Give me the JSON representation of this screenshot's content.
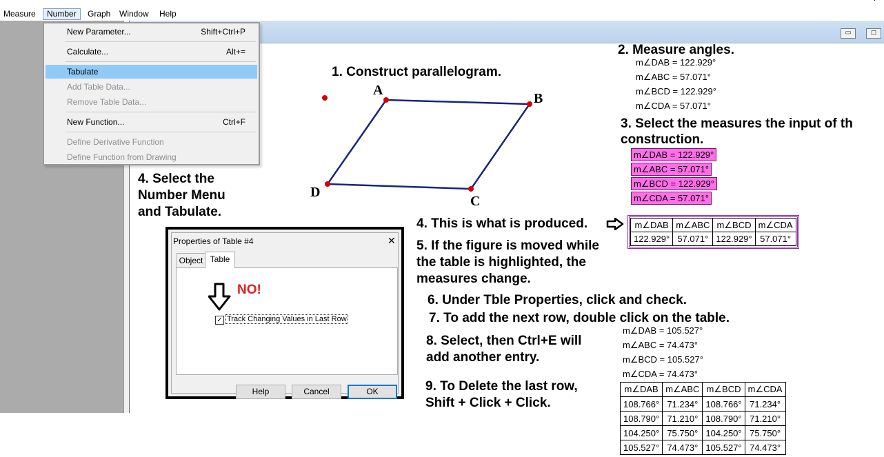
{
  "menubar": [
    "Measure",
    "Number",
    "Graph",
    "Window",
    "Help"
  ],
  "number_menu": [
    {
      "label": "New Parameter...",
      "shortcut": "Shift+Ctrl+P",
      "enabled": true
    },
    {
      "label": "Calculate...",
      "shortcut": "Alt+=",
      "enabled": true
    },
    {
      "label": "Tabulate",
      "shortcut": "",
      "enabled": true,
      "highlighted": true
    },
    {
      "label": "Add Table Data...",
      "shortcut": "",
      "enabled": false
    },
    {
      "label": "Remove Table Data...",
      "shortcut": "",
      "enabled": false
    },
    {
      "label": "New Function...",
      "shortcut": "Ctrl+F",
      "enabled": true
    },
    {
      "label": "Define Derivative Function",
      "shortcut": "",
      "enabled": false
    },
    {
      "label": "Define Function from Drawing",
      "shortcut": "",
      "enabled": false
    }
  ],
  "steps": {
    "s1": "1. Construct parallelogram.",
    "s2": "2. Measure angles.",
    "s3a": "3. Select the measures the input  of th",
    "s3b": "construction.",
    "s4a": "4. Select the",
    "s4b": "Number Menu",
    "s4c": "and Tabulate.",
    "s4p": "4. This is what is produced.",
    "s5a": "5. If the figure is moved while",
    "s5b": "the table is highlighted, the",
    "s5c": "measures change.",
    "s6": "6. Under Tble Properties, click and check.",
    "s7": "7.  To add the next row, double click on the table.",
    "s8a": "8. Select, then Ctrl+E will",
    "s8b": "add another entry.",
    "s9a": "9.  To Delete the last row,",
    "s9b": "Shift + Click + Click."
  },
  "vertices": {
    "A": "A",
    "B": "B",
    "C": "C",
    "D": "D"
  },
  "measures1": [
    "m∠DAB = 122.929°",
    "m∠ABC = 57.071°",
    "m∠BCD = 122.929°",
    "m∠CDA = 57.071°"
  ],
  "selected_measures": [
    "m∠DAB = 122.929°",
    "m∠ABC = 57.071°",
    "m∠BCD = 122.929°",
    "m∠CDA = 57.071°"
  ],
  "table_headers": [
    "m∠DAB",
    "m∠ABC",
    "m∠BCD",
    "m∠CDA"
  ],
  "table1_row": [
    "122.929°",
    "57.071°",
    "122.929°",
    "57.071°"
  ],
  "measures2": [
    "m∠DAB = 105.527°",
    "m∠ABC = 74.473°",
    "m∠BCD = 105.527°",
    "m∠CDA = 74.473°"
  ],
  "table2_rows": [
    [
      "108.766°",
      "71.234°",
      "108.766°",
      "71.234°"
    ],
    [
      "108.790°",
      "71.210°",
      "108.790°",
      "71.210°"
    ],
    [
      "104.250°",
      "75.750°",
      "104.250°",
      "75.750°"
    ],
    [
      "105.527°",
      "74.473°",
      "105.527°",
      "74.473°"
    ]
  ],
  "dialog": {
    "title": "Properties of Table #4",
    "close": "✕",
    "tabs": [
      "Object",
      "Table"
    ],
    "active_tab": "Table",
    "no_label": "NO!",
    "checkbox_label": "Track Changing Values in Last Row",
    "checked": true,
    "buttons": [
      "Help",
      "Cancel",
      "OK"
    ]
  },
  "colors": {
    "pink": "#ff6ee8",
    "no_red": "#e02020",
    "edge": "#1a237e",
    "point": "#d50000",
    "highlight": "#91c9f7"
  }
}
